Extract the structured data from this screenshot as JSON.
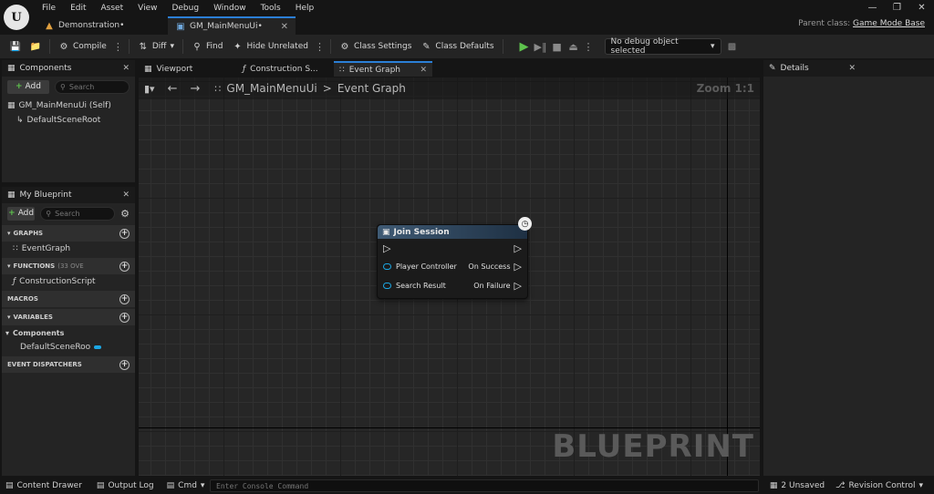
{
  "menu": [
    "File",
    "Edit",
    "Asset",
    "View",
    "Debug",
    "Window",
    "Tools",
    "Help"
  ],
  "logo": "U",
  "tabs": {
    "demo": {
      "label": "Demonstration•"
    },
    "gm": {
      "label": "GM_MainMenuUi•"
    }
  },
  "parent_class": {
    "label": "Parent class:",
    "value": "Game Mode Base"
  },
  "toolbar": {
    "compile": "Compile",
    "diff": "Diff",
    "find": "Find",
    "hide_unrelated": "Hide Unrelated",
    "class_settings": "Class Settings",
    "class_defaults": "Class Defaults",
    "debug_object": "No debug object selected"
  },
  "components_panel": {
    "title": "Components",
    "add": "Add",
    "search_placeholder": "Search",
    "items": [
      "GM_MainMenuUi (Self)",
      "DefaultSceneRoot"
    ]
  },
  "myblueprint_panel": {
    "title": "My Blueprint",
    "add": "Add",
    "search_placeholder": "Search",
    "sections": {
      "graphs": "GRAPHS",
      "graph_item": "EventGraph",
      "functions": "FUNCTIONS",
      "functions_sub": "(33 OVE",
      "function_item": "ConstructionScript",
      "macros": "MACROS",
      "variables": "VARIABLES",
      "components": "Components",
      "component_var": "DefaultSceneRoo",
      "dispatchers": "EVENT DISPATCHERS"
    }
  },
  "graph_tabs": [
    "Viewport",
    "Construction S...",
    "Event Graph"
  ],
  "graph": {
    "breadcrumb_root": "GM_MainMenuUi",
    "breadcrumb_sep": ">",
    "breadcrumb_current": "Event Graph",
    "zoom": "Zoom 1:1",
    "watermark": "BLUEPRINT"
  },
  "node": {
    "title": "Join Session",
    "inputs": [
      "Player Controller",
      "Search Result"
    ],
    "outputs": [
      "On Success",
      "On Failure"
    ],
    "pin_color": "#1ba6e3"
  },
  "details_panel": {
    "title": "Details"
  },
  "bottom": {
    "content_drawer": "Content Drawer",
    "output_log": "Output Log",
    "cmd": "Cmd",
    "console_placeholder": "Enter Console Command",
    "unsaved": "2 Unsaved",
    "revision": "Revision Control"
  },
  "colors": {
    "accent": "#2b7fd6",
    "play": "#5ec34d"
  }
}
